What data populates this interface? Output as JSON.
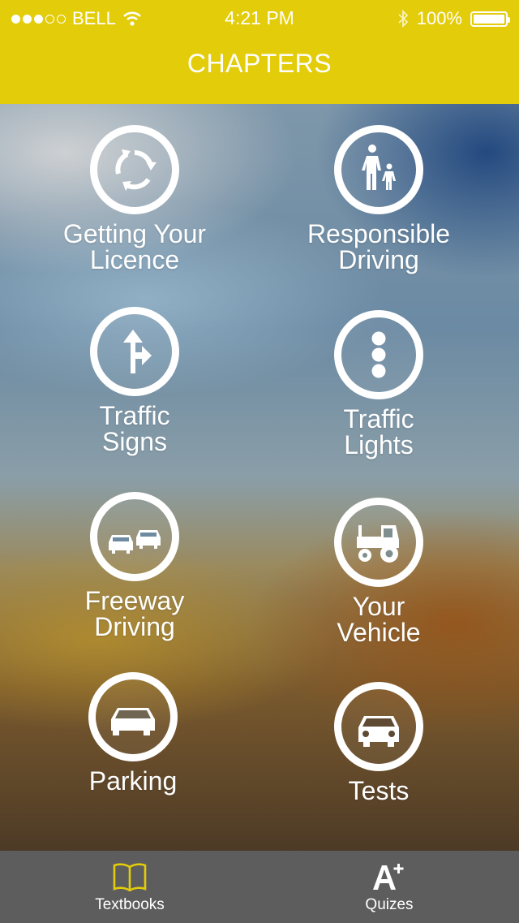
{
  "status_bar": {
    "carrier": "BELL",
    "time": "4:21 PM",
    "battery": "100%",
    "signal_dots_filled": 3,
    "signal_dots_total": 5,
    "battery_level": 1.0
  },
  "header": {
    "title": "CHAPTERS",
    "color": "#e3cc0a"
  },
  "chapters": [
    {
      "label": "Getting Your\nLicence",
      "icon": "roundabout-icon"
    },
    {
      "label": "Responsible\nDriving",
      "icon": "pedestrian-icon"
    },
    {
      "label": "Traffic\nSigns",
      "icon": "direction-arrow-icon"
    },
    {
      "label": "Traffic\nLights",
      "icon": "traffic-light-icon"
    },
    {
      "label": "Freeway\nDriving",
      "icon": "two-cars-icon"
    },
    {
      "label": "Your\nVehicle",
      "icon": "tractor-icon"
    },
    {
      "label": "Parking",
      "icon": "car-icon"
    },
    {
      "label": "Tests",
      "icon": "car-front-icon"
    }
  ],
  "tabbar": {
    "tabs": [
      {
        "label": "Textbooks",
        "icon": "book-icon",
        "active": true,
        "color": "#e3cc0a"
      },
      {
        "label": "Quizes",
        "icon": "a-plus-icon",
        "active": false,
        "color": "#ffffff"
      }
    ]
  }
}
